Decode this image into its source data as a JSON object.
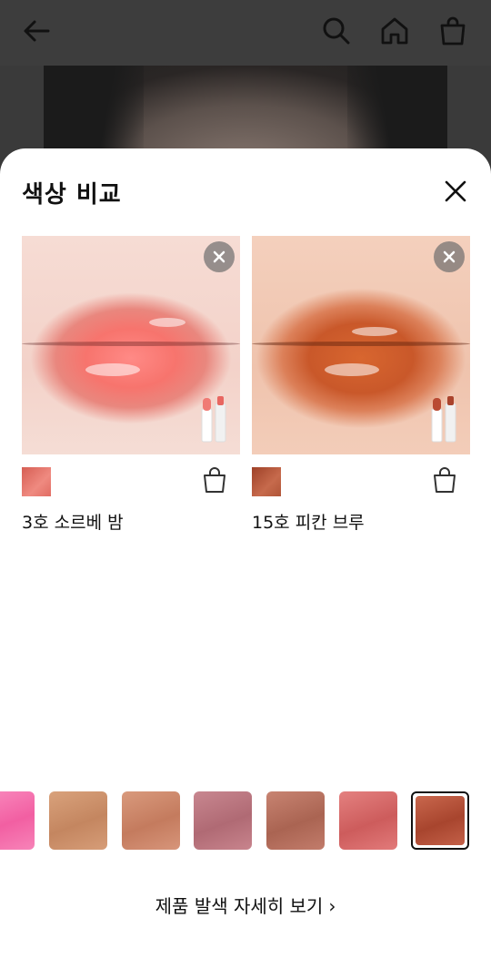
{
  "background_header": {
    "back_icon": "arrow-left-icon",
    "search_icon": "search-icon",
    "home_icon": "home-icon",
    "cart_icon": "shopping-bag-icon"
  },
  "sheet": {
    "title": "색상 비교",
    "close_icon": "close-icon"
  },
  "compare_items": [
    {
      "name": "3호 소르베 밤",
      "swatch_color": "#e7746a",
      "remove_icon": "remove-circle-icon",
      "bag_icon": "shopping-bag-icon"
    },
    {
      "name": "15호 피칸 브루",
      "swatch_color": "#b8583b",
      "remove_icon": "remove-circle-icon",
      "bag_icon": "shopping-bag-icon"
    }
  ],
  "color_strip": [
    {
      "color": "#f46aa9",
      "selected": false
    },
    {
      "color": "#c98f6a",
      "selected": false
    },
    {
      "color": "#c98467",
      "selected": false
    },
    {
      "color": "#b7727c",
      "selected": false
    },
    {
      "color": "#b2705f",
      "selected": false
    },
    {
      "color": "#d46a69",
      "selected": false
    },
    {
      "color": "#b5503a",
      "selected": true
    }
  ],
  "footer": {
    "detail_link": "제품 발색 자세히 보기",
    "chevron_icon": "chevron-right-icon"
  }
}
